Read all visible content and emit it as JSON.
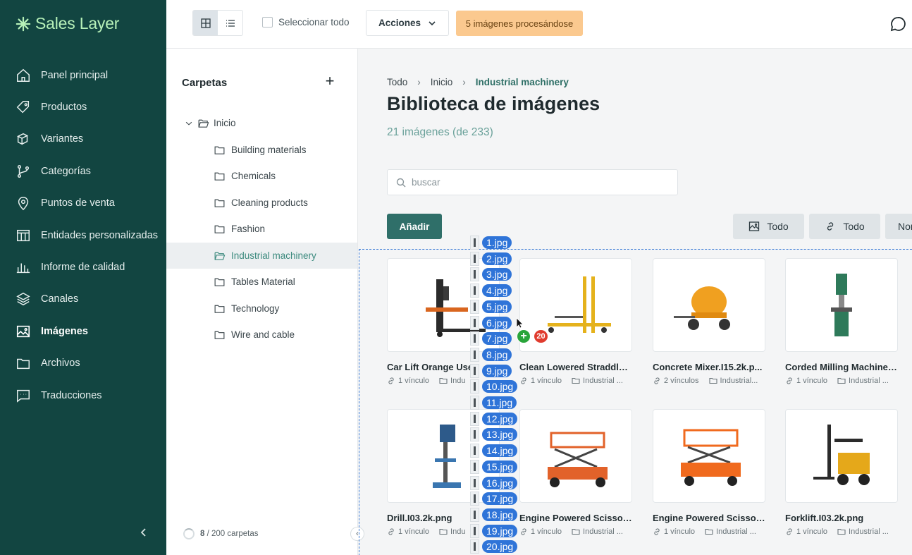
{
  "app": {
    "brand": "Sales Layer",
    "brand_color": "#b6f0b8",
    "sidebar_bg": "#124541",
    "accent": "#2f6f69"
  },
  "sidebar": {
    "items": [
      {
        "label": "Panel principal",
        "icon": "home-icon"
      },
      {
        "label": "Productos",
        "icon": "tag-icon"
      },
      {
        "label": "Variantes",
        "icon": "variants-icon"
      },
      {
        "label": "Categorías",
        "icon": "branch-icon"
      },
      {
        "label": "Puntos de venta",
        "icon": "map-pin-icon"
      },
      {
        "label": "Entidades personalizadas",
        "icon": "columns-icon"
      },
      {
        "label": "Informe de calidad",
        "icon": "bar-chart-icon"
      },
      {
        "label": "Canales",
        "icon": "layers-icon"
      },
      {
        "label": "Imágenes",
        "icon": "image-icon",
        "active": true
      },
      {
        "label": "Archivos",
        "icon": "folder-icon"
      },
      {
        "label": "Traducciones",
        "icon": "chat-bubble-icon"
      }
    ]
  },
  "topbar": {
    "select_all": "Seleccionar todo",
    "actions": "Acciones",
    "processing": "5 imágenes procesándose"
  },
  "folders": {
    "title": "Carpetas",
    "root": "Inicio",
    "children": [
      "Building materials",
      "Chemicals",
      "Cleaning products",
      "Fashion",
      "Industrial machinery",
      "Tables Material",
      "Technology",
      "Wire and cable"
    ],
    "selected": "Industrial machinery",
    "footer_count": "8",
    "footer_total": "/ 200 carpetas"
  },
  "main": {
    "breadcrumb": [
      "Todo",
      "Inicio",
      "Industrial machinery"
    ],
    "title": "Biblioteca de imágenes",
    "count": "21 imágenes (de 233)",
    "search_placeholder": "buscar",
    "add_button": "Añadir",
    "filters": [
      "Todo",
      "Todo",
      "Nom"
    ]
  },
  "cards": [
    {
      "name": "Car Lift Orange Use",
      "links": "1 vínculo",
      "folder": "Indu"
    },
    {
      "name": "Clean Lowered Straddle ...",
      "links": "1 vínculo",
      "folder": "Industrial ..."
    },
    {
      "name": "Concrete Mixer.I15.2k.p...",
      "links": "2 vínculos",
      "folder": "Industrial..."
    },
    {
      "name": "Corded Milling Machine ...",
      "links": "1 vínculo",
      "folder": "Industrial ..."
    },
    {
      "name": "Drill.I03.2k.png",
      "links": "1 vínculo",
      "folder": "Indu"
    },
    {
      "name": "Engine Powered Scissor ...",
      "links": "1 vínculo",
      "folder": "Industrial ..."
    },
    {
      "name": "Engine Powered Scissor ...",
      "links": "1 vínculo",
      "folder": "Industrial ..."
    },
    {
      "name": "Forklift.I03.2k.png",
      "links": "1 vínculo",
      "folder": "Industrial ..."
    }
  ],
  "drag": {
    "files": [
      "1.jpg",
      "2.jpg",
      "3.jpg",
      "4.jpg",
      "5.jpg",
      "6.jpg",
      "7.jpg",
      "8.jpg",
      "9.jpg",
      "10.jpg",
      "11.jpg",
      "12.jpg",
      "13.jpg",
      "14.jpg",
      "15.jpg",
      "16.jpg",
      "17.jpg",
      "18.jpg",
      "19.jpg",
      "20.jpg"
    ],
    "plus": "+",
    "count": "20"
  }
}
